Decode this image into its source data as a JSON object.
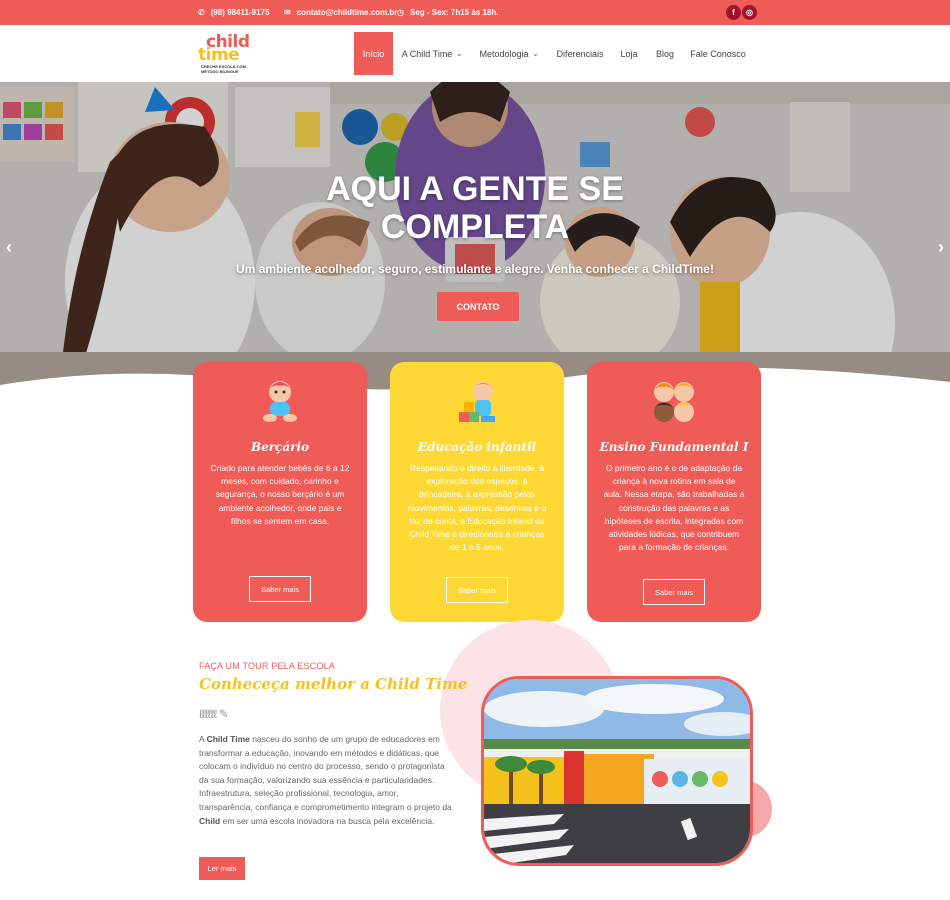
{
  "topbar": {
    "phone": "(98) 98411-9175",
    "email": "contato@childtime.com.br",
    "hours": "Seg - Sex: 7h15 às 18h.",
    "social": [
      {
        "icon": "facebook-icon",
        "glyph": "f"
      },
      {
        "icon": "instagram-icon",
        "glyph": "◎"
      }
    ]
  },
  "logo": {
    "line1": "child",
    "line2": "time",
    "tagline": "CRECHE ESCOLA COM MÉTODO BILÍNGUE"
  },
  "nav": {
    "items": [
      {
        "label": "Início",
        "active": true
      },
      {
        "label": "A Child Time",
        "dropdown": true
      },
      {
        "label": "Metodologia",
        "dropdown": true
      },
      {
        "label": "Diferenciais"
      },
      {
        "label": "Loja"
      },
      {
        "label": "Blog"
      },
      {
        "label": "Fale Conosco"
      }
    ],
    "chevron": "⌄"
  },
  "hero": {
    "title_line1": "AQUI A GENTE SE",
    "title_line2": "COMPLETA",
    "subtitle": "Um ambiente acolhedor, seguro, estimulante e alegre. Venha conhecer a ChildTime!",
    "button": "CONTATO",
    "prev": "‹",
    "next": "›"
  },
  "cards": [
    {
      "title": "Berçário",
      "text": "Criado para atender bebês de 6 a 12 meses, com cuidado, carinho e segurança, o nosso berçário é um ambiente acolhedor, onde pais e filhos se sentem em casa.",
      "button": "Saber mais",
      "icon": "baby-icon"
    },
    {
      "title": "Educação infantil",
      "text": "Respeitando o direito à liberdade, à exploração dos espaços, à brincadeira, à expressão pelos movimentos, palavras, desenhos e o faz de conta, a Educação Infantil da Child Time é direcionada a crianças de 1 a 5 anos.",
      "button": "Saber mais",
      "icon": "child-blocks-icon"
    },
    {
      "title": "Ensino Fundamental I",
      "text": "O primeiro ano é o de adaptação da criança à nova rotina em sala de aula. Nessa etapa, são trabalhadas a construção das palavras e as hipóteses de escrita, integradas com atividades lúdicas, que contribuem para a formação de crianças.",
      "button": "Saber mais",
      "icon": "children-faces-icon"
    }
  ],
  "about": {
    "kicker": "FAÇA UM TOUR PELA ESCOLA",
    "title": "Conheceça melhor a Child Time",
    "text_a": "A ",
    "text_b": "Child Time",
    "text_c": " nasceu do sonho de um grupo de educadores em transformar a educação, inovando em métodos e didáticas, que colocam o indivíduo no centro do processo, sendo o protagonista da sua formação, valorizando sua essência e particularidades. Infraestrutura, seleção profissional, tecnologia, amor, transparência, confiança e comprometimento integram o projeto da ",
    "text_d": "Child",
    "text_e": " em ser uma escola inovadora na busca pela excelência.",
    "button": "Ler mais",
    "squiggle": "ℓℓℓℓℓℓ ✎"
  },
  "colors": {
    "primary": "#ef5b57",
    "yellow": "#fdd835",
    "dark_red": "#a1132c"
  }
}
